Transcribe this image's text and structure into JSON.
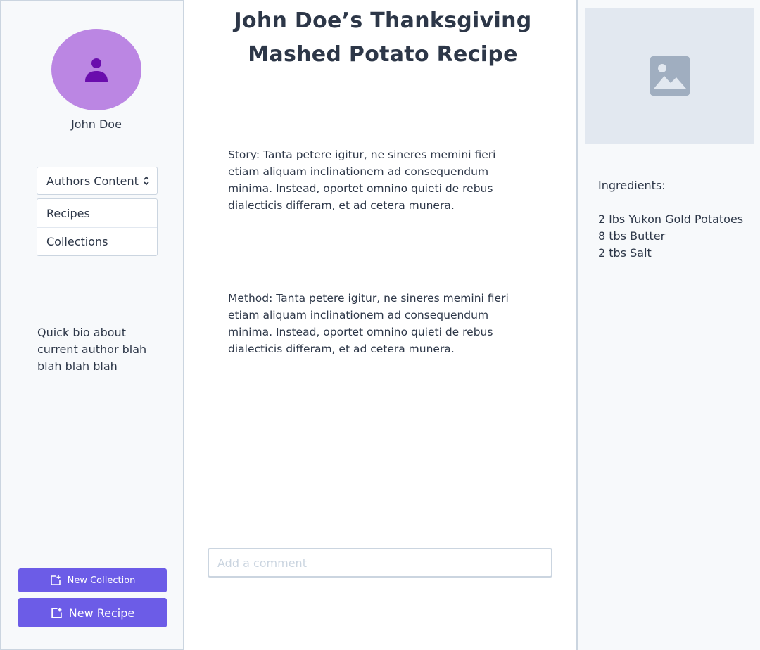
{
  "author": {
    "name": "John Doe",
    "bio": "Quick bio about current author blah blah blah blah"
  },
  "content_select": {
    "selected": "Authors Content",
    "options": [
      "Recipes",
      "Collections"
    ]
  },
  "buttons": {
    "new_collection": "New Collection",
    "new_recipe": "New Recipe"
  },
  "recipe": {
    "title": "John Doe’s Thanksgiving Mashed Potato Recipe",
    "story": "Story: Tanta petere igitur, ne sineres memini fieri etiam aliquam inclinationem ad consequendum minima. Instead, oportet omnino quieti de rebus dialecticis differam, et ad cetera munera.",
    "method": "Method: Tanta petere igitur, ne sineres memini fieri etiam aliquam inclinationem ad consequendum minima. Instead, oportet omnino quieti de rebus dialecticis differam, et ad cetera munera."
  },
  "comment": {
    "placeholder": "Add a comment",
    "value": ""
  },
  "ingredients": {
    "heading": "Ingredients:",
    "items": [
      "2 lbs Yukon Gold Potatoes",
      "8 tbs Butter",
      "2 tbs Salt"
    ]
  },
  "icons": {
    "avatar": "user-icon",
    "select": "chevron-up-down-icon",
    "button": "add-document-icon",
    "photo": "image-icon"
  },
  "colors": {
    "accent": "#6c5ce7",
    "avatar_bg": "#bb86e3",
    "avatar_icon": "#6a0dad",
    "placeholder_bg": "#e2e8f0",
    "placeholder_icon": "#a0aec0",
    "text": "#2d3748",
    "border": "#cbd5e0"
  }
}
